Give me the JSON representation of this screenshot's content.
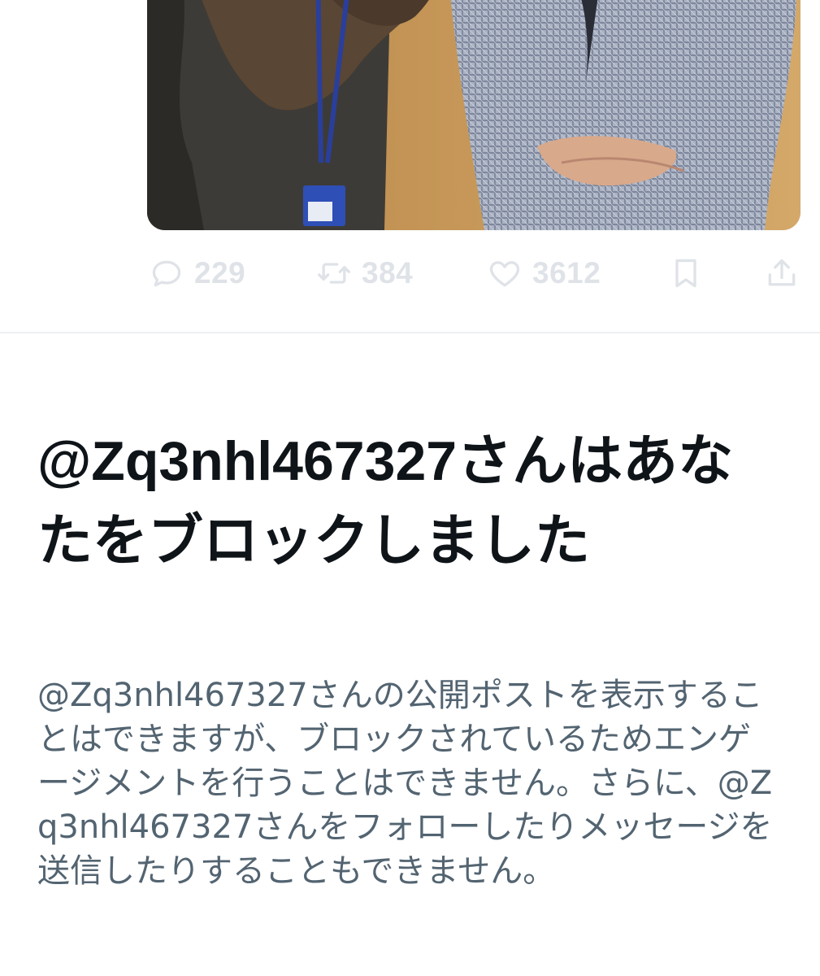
{
  "tweet": {
    "image_alt": "photo of two people standing side by side",
    "actions": {
      "reply": {
        "icon": "reply-icon",
        "count": "229"
      },
      "retweet": {
        "icon": "retweet-icon",
        "count": "384"
      },
      "like": {
        "icon": "heart-icon",
        "count": "3612"
      },
      "bookmark": {
        "icon": "bookmark-icon"
      },
      "share": {
        "icon": "share-icon"
      }
    }
  },
  "blocked_notice": {
    "title": "@Zq3nhl467327さんはあなたをブロックしました",
    "description": "@Zq3nhl467327さんの公開ポストを表示することはできますが、ブロックされているためエンゲージメントを行うことはできません。さらに、@Zq3nhl467327さんをフォローしたりメッセージを送信したりすることもできません。"
  },
  "colors": {
    "title_text": "#0f1419",
    "body_text": "#536471",
    "action_icon": "#dfe3e8",
    "divider": "#eceff1"
  }
}
